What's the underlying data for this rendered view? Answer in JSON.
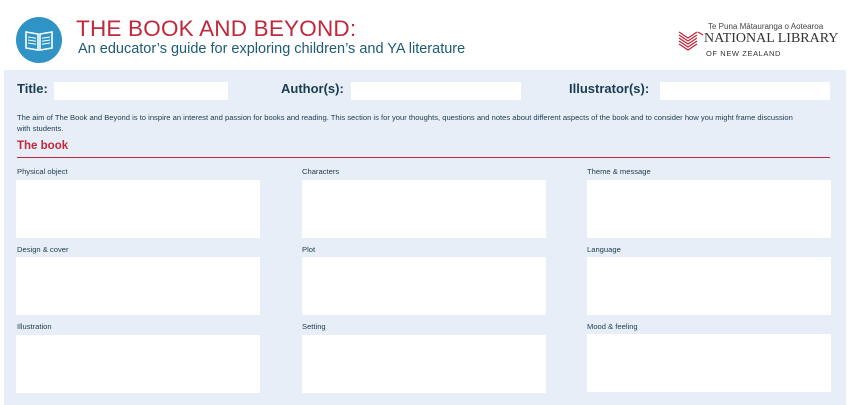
{
  "header": {
    "title": "THE BOOK AND BEYOND:",
    "subtitle": "An educator’s guide for exploring children’s and YA literature",
    "logo_icon": "open-book-icon",
    "library": {
      "maori_name": "Te Puna Mātauranga o Aotearoa",
      "name": "NATIONAL LIBRARY",
      "country": "OF NEW ZEALAND"
    }
  },
  "fields": {
    "title_label": "Title:",
    "title_value": "",
    "author_label": "Author(s):",
    "author_value": "",
    "illustrator_label": "Illustrator(s):",
    "illustrator_value": ""
  },
  "intro": "The aim of The Book and Beyond is to inspire an interest and passion for books and reading. This section is for  your thoughts, questions and notes about different aspects of the book and to consider how you might frame discussion with students.",
  "section": {
    "title": "The book",
    "items": [
      {
        "label": "Physical object",
        "value": ""
      },
      {
        "label": "Characters",
        "value": ""
      },
      {
        "label": "Theme & message",
        "value": ""
      },
      {
        "label": "Design & cover",
        "value": ""
      },
      {
        "label": "Plot",
        "value": ""
      },
      {
        "label": "Language",
        "value": ""
      },
      {
        "label": "Illustration",
        "value": ""
      },
      {
        "label": "Setting",
        "value": ""
      },
      {
        "label": "Mood & feeling",
        "value": ""
      }
    ]
  },
  "colors": {
    "accent_red": "#c1283b",
    "heading_teal": "#1e5b74",
    "logo_blue": "#2f94c5",
    "panel_bg": "#e7eef8"
  }
}
